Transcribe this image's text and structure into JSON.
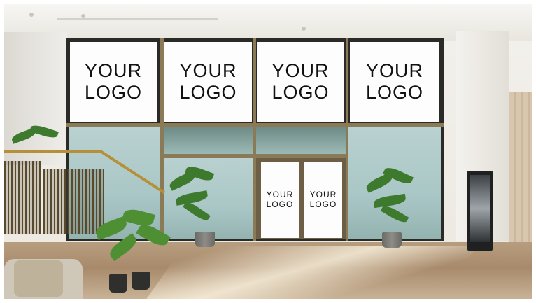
{
  "scene": {
    "description_alt": "",
    "top_panels": [
      {
        "line1": "YOUR",
        "line2": "LOGO"
      },
      {
        "line1": "YOUR",
        "line2": "LOGO"
      },
      {
        "line1": "YOUR",
        "line2": "LOGO"
      },
      {
        "line1": "YOUR",
        "line2": "LOGO"
      }
    ],
    "door_panels": [
      {
        "line1": "YOUR",
        "line2": "LOGO"
      },
      {
        "line1": "YOUR",
        "line2": "LOGO"
      }
    ],
    "colors": {
      "frame": "#8a7a55",
      "glass": "#a9c7c6",
      "panel": "#fdfdfd",
      "floor": "#a88a6b",
      "plant": "#3e7a2d",
      "rail": "#b58f3a"
    }
  }
}
